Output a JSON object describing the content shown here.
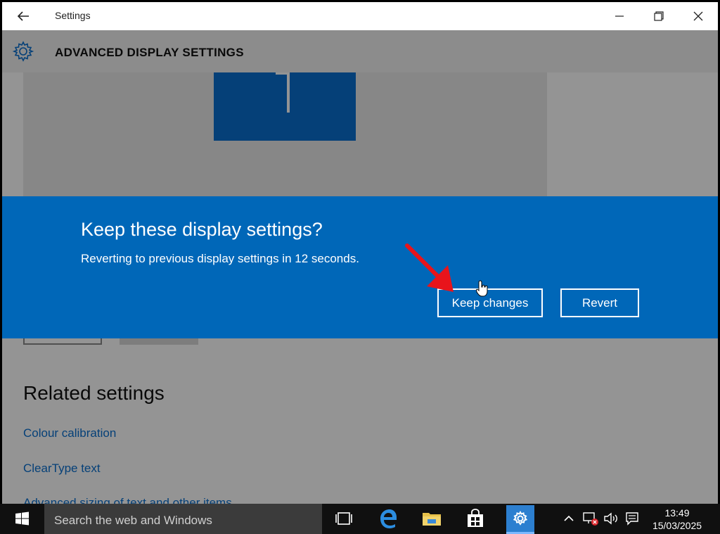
{
  "window": {
    "title": "Settings",
    "header_title": "ADVANCED DISPLAY SETTINGS"
  },
  "content": {
    "related_title": "Related settings",
    "links": [
      "Colour calibration",
      "ClearType text",
      "Advanced sizing of text and other items"
    ]
  },
  "dialog": {
    "title": "Keep these display settings?",
    "message": "Reverting to previous display settings in 12 seconds.",
    "keep_label": "Keep changes",
    "revert_label": "Revert"
  },
  "taskbar": {
    "search_placeholder": "Search the web and Windows",
    "time": "13:49",
    "date": "15/03/2025"
  },
  "colors": {
    "accent": "#0067b8",
    "link": "#0a6fcf",
    "annotation_arrow": "#e8141b"
  }
}
